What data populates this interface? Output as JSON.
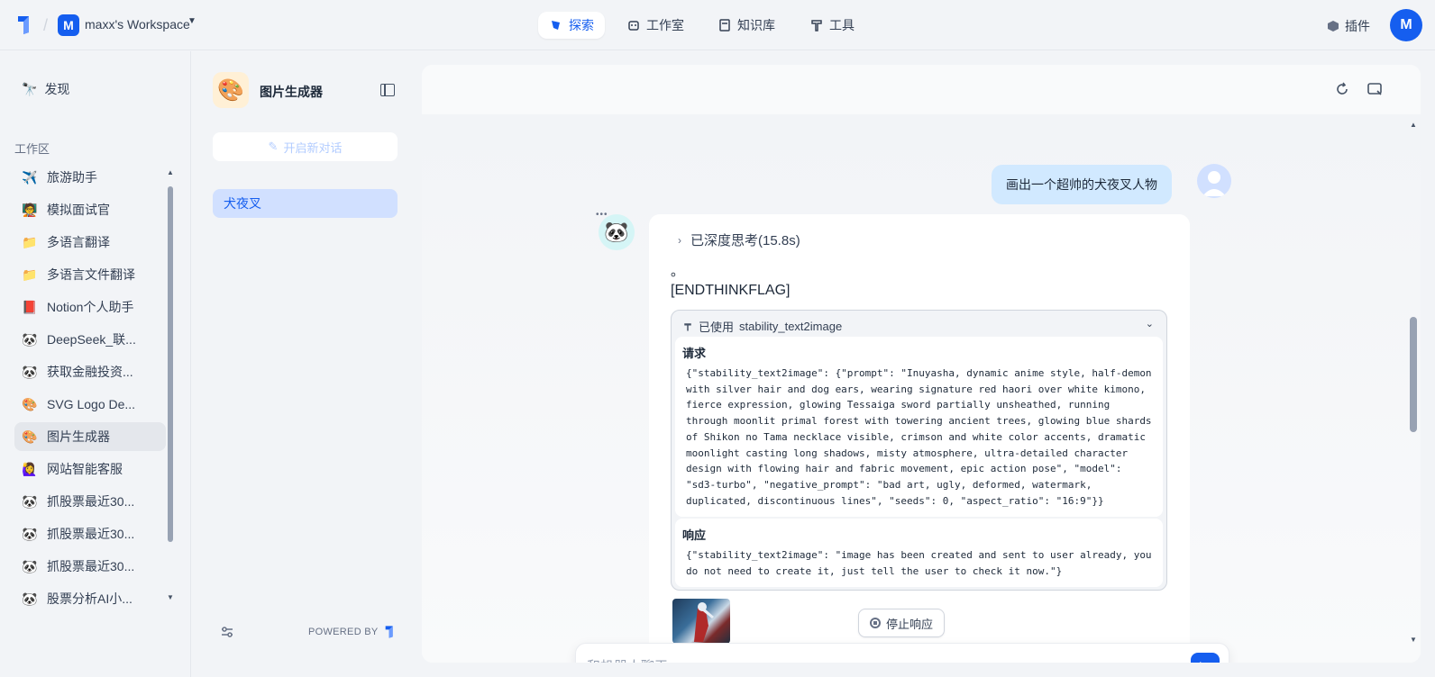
{
  "topbar": {
    "workspace_initial": "M",
    "workspace_name": "maxx's Workspace",
    "nav": [
      {
        "label": "探索",
        "icon": "compass-icon",
        "active": true
      },
      {
        "label": "工作室",
        "icon": "robot-icon",
        "active": false
      },
      {
        "label": "知识库",
        "icon": "book-icon",
        "active": false
      },
      {
        "label": "工具",
        "icon": "hammer-icon",
        "active": false
      }
    ],
    "plugin_label": "插件",
    "user_initial": "M"
  },
  "sidebar": {
    "discover_label": "发现",
    "workspace_label": "工作区",
    "items": [
      {
        "label": "旅游助手",
        "icon": "✈️"
      },
      {
        "label": "模拟面试官",
        "icon": "🧑‍🏫"
      },
      {
        "label": "多语言翻译",
        "icon": "📁"
      },
      {
        "label": "多语言文件翻译",
        "icon": "📁"
      },
      {
        "label": "Notion个人助手",
        "icon": "📕"
      },
      {
        "label": "DeepSeek_联...",
        "icon": "🐼"
      },
      {
        "label": "获取金融投资...",
        "icon": "🐼"
      },
      {
        "label": "SVG Logo De...",
        "icon": "🎨"
      },
      {
        "label": "图片生成器",
        "icon": "🎨"
      },
      {
        "label": "网站智能客服",
        "icon": "🙋‍♀️"
      },
      {
        "label": "抓股票最近30...",
        "icon": "🐼"
      },
      {
        "label": "抓股票最近30...",
        "icon": "🐼"
      },
      {
        "label": "抓股票最近30...",
        "icon": "🐼"
      },
      {
        "label": "股票分析AI小...",
        "icon": "🐼"
      }
    ]
  },
  "panel": {
    "app_name": "图片生成器",
    "new_chat_label": "开启新对话",
    "conversation": "犬夜叉",
    "powered_by": "POWERED BY"
  },
  "chat": {
    "user_message": "画出一个超帅的犬夜叉人物",
    "think_label": "已深度思考(15.8s)",
    "answer_dot": "。",
    "answer_flag": "[ENDTHINKFLAG]",
    "tool_used_prefix": "已使用",
    "tool_name": "stability_text2image",
    "request_label": "请求",
    "request_body": "{\"stability_text2image\": {\"prompt\": \"Inuyasha, dynamic anime style, half-demon with silver hair and dog ears, wearing signature red haori over white kimono, fierce expression, glowing Tessaiga sword partially unsheathed, running through moonlit primal forest with towering ancient trees, glowing blue shards of Shikon no Tama necklace visible, crimson and white color accents, dramatic moonlight casting long shadows, misty atmosphere, ultra-detailed character design with flowing hair and fabric movement, epic action pose\", \"model\": \"sd3-turbo\", \"negative_prompt\": \"bad art, ugly, deformed, watermark, duplicated, discontinuous lines\", \"seeds\": 0, \"aspect_ratio\": \"16:9\"}}",
    "response_label": "响应",
    "response_body": "{\"stability_text2image\": \"image has been created and sent to user already, you do not need to create it, just tell the user to check it now.\"}",
    "stop_label": "停止响应",
    "input_placeholder": "和机器人聊天"
  },
  "colors": {
    "accent": "#155eef",
    "user_bubble": "#d1e9ff",
    "active_conversation": "#d1e0ff"
  }
}
